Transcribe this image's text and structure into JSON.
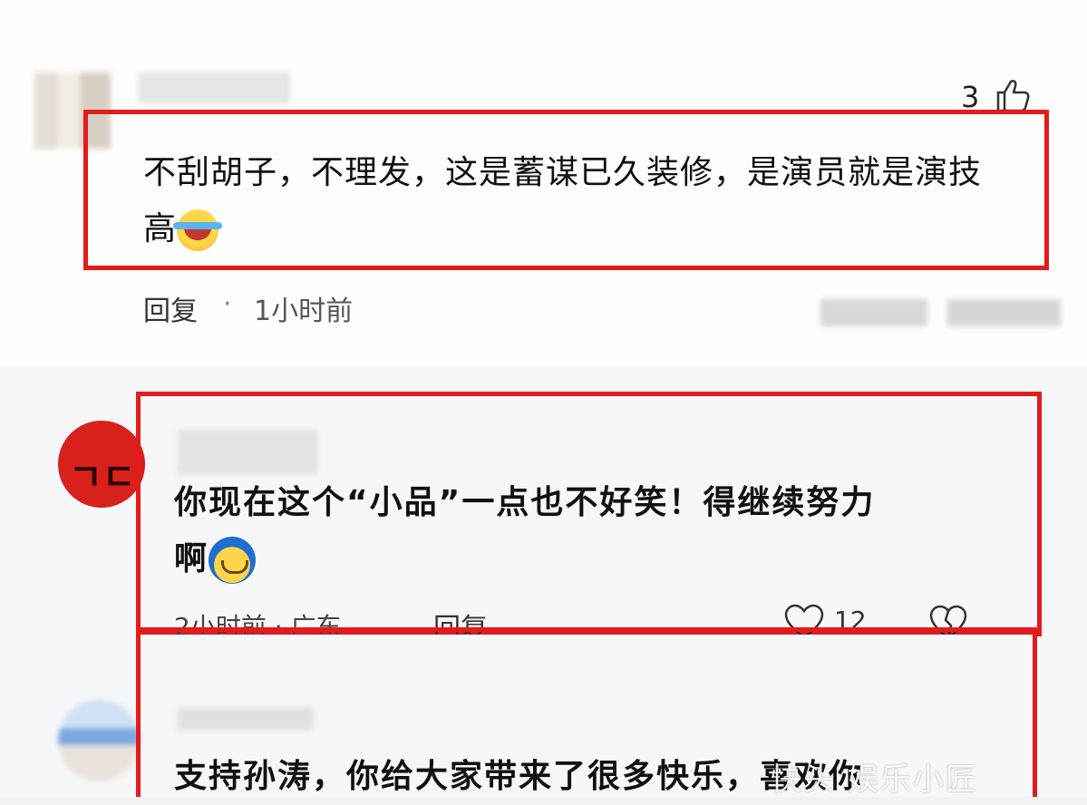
{
  "comment1": {
    "like_count": "3",
    "text_line1": "不刮胡子，不理发，这是蓄谋已久装修，是演员就是演技",
    "text_line2": "高",
    "reply_label": "回复",
    "separator": "·",
    "time": "1小时前",
    "emoji": "laughing-crying-emoji"
  },
  "comment2": {
    "text_line1": "你现在这个“小品”一点也不好笑！得继续努力",
    "text_line2": "啊",
    "time_location": "2小时前 · 广东",
    "reply_label": "回复",
    "like_count": "12",
    "emoji": "smirk-emoji"
  },
  "comment3": {
    "text": "支持孙涛，你给大家带来了很多快乐，喜欢你"
  },
  "watermark": "快头 娱乐小匠"
}
